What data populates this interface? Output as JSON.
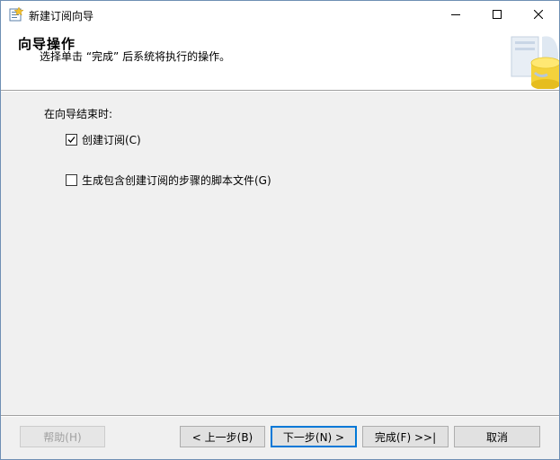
{
  "window": {
    "title": "新建订阅向导",
    "controls": {
      "minimize": "minimize",
      "maximize": "maximize",
      "close": "close"
    }
  },
  "header": {
    "title": "向导操作",
    "subtitle": "选择单击 “完成” 后系统将执行的操作。"
  },
  "body": {
    "prompt": "在向导结束时:",
    "options": [
      {
        "label": "创建订阅(C)",
        "checked": true
      },
      {
        "label": "生成包含创建订阅的步骤的脚本文件(G)",
        "checked": false
      }
    ]
  },
  "footer": {
    "help": "帮助(H)",
    "back": "< 上一步(B)",
    "next": "下一步(N) >",
    "finish": "完成(F) >>|",
    "cancel": "取消"
  },
  "colors": {
    "accent": "#0078d7",
    "frame": "#6f8fb4",
    "face": "#f0f0f0"
  },
  "icons": [
    "app-icon",
    "minimize-icon",
    "maximize-icon",
    "close-icon",
    "database-wizard-graphic",
    "checkmark-icon"
  ]
}
